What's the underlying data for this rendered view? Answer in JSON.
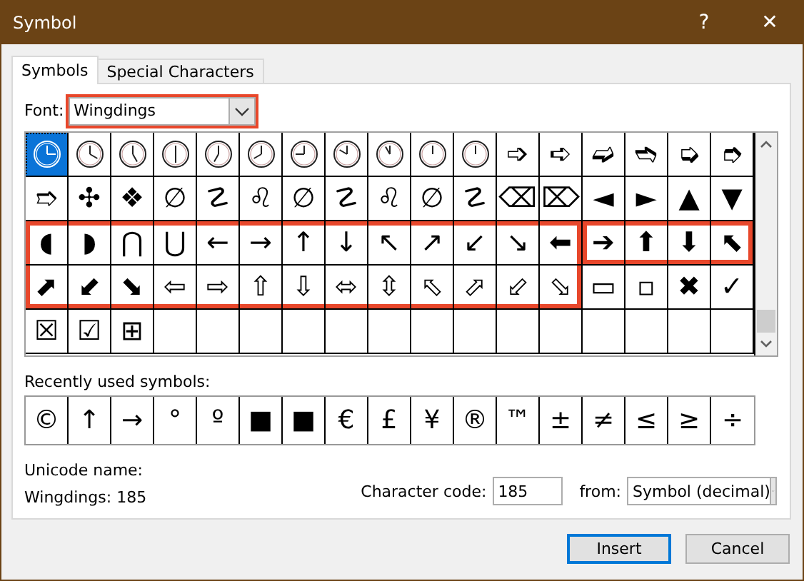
{
  "window": {
    "title": "Symbol",
    "help": "?",
    "close": "✕"
  },
  "tabs": [
    {
      "label": "Symbols",
      "selected": true
    },
    {
      "label": "Special Characters",
      "selected": false
    }
  ],
  "font": {
    "label": "Font:",
    "value": "Wingdings",
    "highlighted": true
  },
  "grid": {
    "rows": [
      [
        {
          "kind": "clock",
          "selected": true
        },
        {
          "kind": "clock",
          "selected": false
        },
        {
          "kind": "clock",
          "selected": false
        },
        {
          "kind": "clock",
          "selected": false
        },
        {
          "kind": "clock",
          "selected": false
        },
        {
          "kind": "clock",
          "selected": false
        },
        {
          "kind": "clock",
          "selected": false
        },
        {
          "kind": "clock",
          "selected": false
        },
        {
          "kind": "clock",
          "selected": false
        },
        {
          "kind": "clock",
          "selected": false
        },
        {
          "kind": "clock",
          "selected": false
        },
        {
          "kind": "glyph",
          "symbol": "➩",
          "selected": false
        },
        {
          "kind": "glyph",
          "symbol": "➪",
          "selected": false
        },
        {
          "kind": "glyph",
          "symbol": "➫",
          "selected": false
        },
        {
          "kind": "glyph",
          "symbol": "➬",
          "selected": false
        },
        {
          "kind": "glyph",
          "symbol": "➭",
          "selected": false
        },
        {
          "kind": "glyph",
          "symbol": "➮",
          "selected": false
        }
      ],
      [
        {
          "kind": "glyph",
          "symbol": "➱",
          "selected": false
        },
        {
          "kind": "glyph",
          "symbol": "✣",
          "selected": false
        },
        {
          "kind": "glyph",
          "symbol": "❖",
          "selected": false
        },
        {
          "kind": "glyph",
          "symbol": "∅",
          "selected": false
        },
        {
          "kind": "glyph",
          "symbol": "☡",
          "selected": false
        },
        {
          "kind": "glyph",
          "symbol": "♌",
          "selected": false
        },
        {
          "kind": "glyph",
          "symbol": "∅",
          "selected": false
        },
        {
          "kind": "glyph",
          "symbol": "☡",
          "selected": false
        },
        {
          "kind": "glyph",
          "symbol": "♌",
          "selected": false
        },
        {
          "kind": "glyph",
          "symbol": "∅",
          "selected": false
        },
        {
          "kind": "glyph",
          "symbol": "☡",
          "selected": false
        },
        {
          "kind": "glyph",
          "symbol": "⌫",
          "selected": false
        },
        {
          "kind": "glyph",
          "symbol": "⌦",
          "selected": false
        },
        {
          "kind": "glyph",
          "symbol": "◄",
          "selected": false
        },
        {
          "kind": "glyph",
          "symbol": "►",
          "selected": false
        },
        {
          "kind": "glyph",
          "symbol": "▲",
          "selected": false
        },
        {
          "kind": "glyph",
          "symbol": "▼",
          "selected": false
        }
      ],
      [
        {
          "kind": "glyph",
          "symbol": "◖",
          "selected": false,
          "highlighted": true
        },
        {
          "kind": "glyph",
          "symbol": "◗",
          "selected": false,
          "highlighted": true
        },
        {
          "kind": "glyph",
          "symbol": "⋂",
          "selected": false,
          "highlighted": true
        },
        {
          "kind": "glyph",
          "symbol": "⋃",
          "selected": false,
          "highlighted": true
        },
        {
          "kind": "glyph",
          "symbol": "←",
          "selected": false,
          "highlighted": true
        },
        {
          "kind": "glyph",
          "symbol": "→",
          "selected": false,
          "highlighted": true
        },
        {
          "kind": "glyph",
          "symbol": "↑",
          "selected": false,
          "highlighted": true
        },
        {
          "kind": "glyph",
          "symbol": "↓",
          "selected": false,
          "highlighted": true
        },
        {
          "kind": "glyph",
          "symbol": "↖",
          "selected": false,
          "highlighted": true
        },
        {
          "kind": "glyph",
          "symbol": "↗",
          "selected": false,
          "highlighted": true
        },
        {
          "kind": "glyph",
          "symbol": "↙",
          "selected": false,
          "highlighted": true
        },
        {
          "kind": "glyph",
          "symbol": "↘",
          "selected": false,
          "highlighted": true
        },
        {
          "kind": "glyph",
          "symbol": "⬅",
          "selected": false,
          "highlighted": true
        },
        {
          "kind": "glyph",
          "symbol": "➔",
          "selected": false,
          "highlighted": true,
          "highlight_break": true
        },
        {
          "kind": "glyph",
          "symbol": "⬆",
          "selected": false,
          "highlighted": true,
          "highlight_break": true
        },
        {
          "kind": "glyph",
          "symbol": "⬇",
          "selected": false,
          "highlighted": true,
          "highlight_break": true
        },
        {
          "kind": "glyph",
          "symbol": "⬉",
          "selected": false,
          "highlighted": true,
          "highlight_break": true
        }
      ],
      [
        {
          "kind": "glyph",
          "symbol": "⬈",
          "selected": false,
          "highlighted": true
        },
        {
          "kind": "glyph",
          "symbol": "⬋",
          "selected": false,
          "highlighted": true
        },
        {
          "kind": "glyph",
          "symbol": "⬊",
          "selected": false,
          "highlighted": true
        },
        {
          "kind": "glyph",
          "symbol": "⇦",
          "selected": false,
          "highlighted": true
        },
        {
          "kind": "glyph",
          "symbol": "⇨",
          "selected": false,
          "highlighted": true
        },
        {
          "kind": "glyph",
          "symbol": "⇧",
          "selected": false,
          "highlighted": true
        },
        {
          "kind": "glyph",
          "symbol": "⇩",
          "selected": false,
          "highlighted": true
        },
        {
          "kind": "glyph",
          "symbol": "⬄",
          "selected": false,
          "highlighted": true
        },
        {
          "kind": "glyph",
          "symbol": "⇳",
          "selected": false,
          "highlighted": true
        },
        {
          "kind": "glyph",
          "symbol": "⬁",
          "selected": false,
          "highlighted": true
        },
        {
          "kind": "glyph",
          "symbol": "⬀",
          "selected": false,
          "highlighted": true
        },
        {
          "kind": "glyph",
          "symbol": "⬃",
          "selected": false,
          "highlighted": true
        },
        {
          "kind": "glyph",
          "symbol": "⬂",
          "selected": false,
          "highlighted": true
        },
        {
          "kind": "glyph",
          "symbol": "▭",
          "selected": false
        },
        {
          "kind": "glyph",
          "symbol": "▫",
          "selected": false
        },
        {
          "kind": "glyph",
          "symbol": "✖",
          "selected": false
        },
        {
          "kind": "glyph",
          "symbol": "✓",
          "selected": false
        }
      ],
      [
        {
          "kind": "glyph",
          "symbol": "☒",
          "selected": false
        },
        {
          "kind": "glyph",
          "symbol": "☑",
          "selected": false
        },
        {
          "kind": "glyph",
          "symbol": "⊞",
          "selected": false
        }
      ]
    ]
  },
  "recent": {
    "label": "Recently used symbols:",
    "symbols": [
      "©",
      "↑",
      "→",
      "°",
      "º",
      "■",
      "■",
      "€",
      "£",
      "¥",
      "®",
      "™",
      "±",
      "≠",
      "≤",
      "≥",
      "÷"
    ]
  },
  "unicode_name": {
    "label": "Unicode name:",
    "value": "Wingdings: 185"
  },
  "character_code": {
    "label": "Character code:",
    "value": "185"
  },
  "from": {
    "label": "from:",
    "value": "Symbol (decimal)"
  },
  "buttons": [
    {
      "label": "Insert",
      "default": true
    },
    {
      "label": "Cancel",
      "default": false
    }
  ]
}
